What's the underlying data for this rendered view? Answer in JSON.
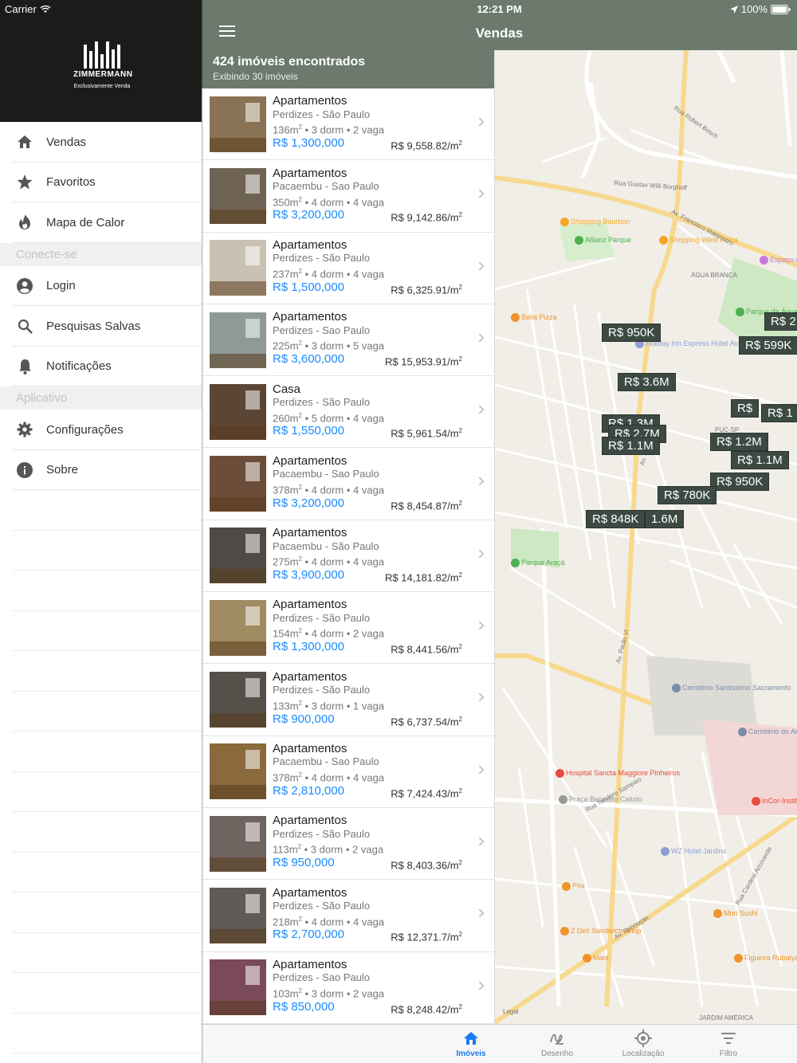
{
  "status": {
    "carrier": "Carrier",
    "time": "12:21 PM",
    "battery": "100%"
  },
  "sidebar": {
    "logo": {
      "brand": "ZIMMERMANN",
      "tagline": "Exclusivamente Venda"
    },
    "items": [
      {
        "label": "Vendas",
        "icon": "home-icon"
      },
      {
        "label": "Favoritos",
        "icon": "star-icon"
      },
      {
        "label": "Mapa de Calor",
        "icon": "flame-icon"
      }
    ],
    "section_connect": "Conecte-se",
    "connect_items": [
      {
        "label": "Login",
        "icon": "account-icon"
      },
      {
        "label": "Pesquisas Salvas",
        "icon": "search-icon"
      },
      {
        "label": "Notificações",
        "icon": "bell-icon"
      }
    ],
    "section_app": "Aplicativo",
    "app_items": [
      {
        "label": "Configurações",
        "icon": "gear-icon"
      },
      {
        "label": "Sobre",
        "icon": "info-icon"
      }
    ]
  },
  "header": {
    "title": "Vendas"
  },
  "list": {
    "count": "424 imóveis encontrados",
    "showing": "Exibindo 30 imóveis",
    "items": [
      {
        "type": "Apartamentos",
        "location": "Perdizes - São Paulo",
        "area": "136m",
        "dorm": "3 dorm",
        "vaga": "2 vaga",
        "price": "R$ 1,300,000",
        "ppm": "R$ 9,558.82/m",
        "color": "#8a7355"
      },
      {
        "type": "Apartamentos",
        "location": "Pacaembu - Sao Paulo",
        "area": "350m",
        "dorm": "4 dorm",
        "vaga": "4 vaga",
        "price": "R$ 3,200,000",
        "ppm": "R$ 9,142.86/m",
        "color": "#6e6252"
      },
      {
        "type": "Apartamentos",
        "location": "Perdizes - São Paulo",
        "area": "237m",
        "dorm": "4 dorm",
        "vaga": "4 vaga",
        "price": "R$ 1,500,000",
        "ppm": "R$ 6,325.91/m",
        "color": "#c9c2b4"
      },
      {
        "type": "Apartamentos",
        "location": "Perdizes - Sao Paulo",
        "area": "225m",
        "dorm": "3 dorm",
        "vaga": "5 vaga",
        "price": "R$ 3,600,000",
        "ppm": "R$ 15,953.91/m",
        "color": "#8d9a95"
      },
      {
        "type": "Casa",
        "location": "Perdizes - São Paulo",
        "area": "260m",
        "dorm": "5 dorm",
        "vaga": "4 vaga",
        "price": "R$ 1,550,000",
        "ppm": "R$ 5,961.54/m",
        "color": "#5b4636"
      },
      {
        "type": "Apartamentos",
        "location": "Pacaembu - Sao Paulo",
        "area": "378m",
        "dorm": "4 dorm",
        "vaga": "4 vaga",
        "price": "R$ 3,200,000",
        "ppm": "R$ 8,454.87/m",
        "color": "#6d4c3a"
      },
      {
        "type": "Apartamentos",
        "location": "Pacaembu - São Paulo",
        "area": "275m",
        "dorm": "4 dorm",
        "vaga": "4 vaga",
        "price": "R$ 3,900,000",
        "ppm": "R$ 14,181.82/m",
        "color": "#4f4a45"
      },
      {
        "type": "Apartamentos",
        "location": "Perdizes - São Paulo",
        "area": "154m",
        "dorm": "4 dorm",
        "vaga": "2 vaga",
        "price": "R$ 1,300,000",
        "ppm": "R$ 8,441.56/m",
        "color": "#a08b63"
      },
      {
        "type": "Apartamentos",
        "location": "Perdizes - São Paulo",
        "area": "133m",
        "dorm": "3 dorm",
        "vaga": "1 vaga",
        "price": "R$ 900,000",
        "ppm": "R$ 6,737.54/m",
        "color": "#55504a"
      },
      {
        "type": "Apartamentos",
        "location": "Pacaembu - Sao Paulo",
        "area": "378m",
        "dorm": "4 dorm",
        "vaga": "4 vaga",
        "price": "R$ 2,810,000",
        "ppm": "R$ 7,424.43/m",
        "color": "#8a6a3c"
      },
      {
        "type": "Apartamentos",
        "location": "Perdizes - São Paulo",
        "area": "113m",
        "dorm": "3 dorm",
        "vaga": "2 vaga",
        "price": "R$ 950,000",
        "ppm": "R$ 8,403.36/m",
        "color": "#6f6460"
      },
      {
        "type": "Apartamentos",
        "location": "Perdizes - São Paulo",
        "area": "218m",
        "dorm": "4 dorm",
        "vaga": "4 vaga",
        "price": "R$ 2,700,000",
        "ppm": "R$ 12,371.7/m",
        "color": "#5f5a55"
      },
      {
        "type": "Apartamentos",
        "location": "Perdizes - Sao Paulo",
        "area": "103m",
        "dorm": "3 dorm",
        "vaga": "2 vaga",
        "price": "R$ 850,000",
        "ppm": "R$ 8,248.42/m",
        "color": "#7a4a5a"
      }
    ]
  },
  "map": {
    "markers": [
      "R$ 950K",
      "R$ 3.6M",
      "R$ 1.3M",
      "R$ 2.7M",
      "R$ 1.1M",
      "R$ 1.2M",
      "R$ 1.1M",
      "R$ 950K",
      "R$ 780K",
      "R$ 848K",
      "1.6M",
      "R$ 599K",
      "R$ 2",
      "R$ 1",
      "R$"
    ],
    "pois": [
      {
        "label": "Shopping Bourbon",
        "color": "#f5a623"
      },
      {
        "label": "Allianz Parque",
        "color": "#4caf50"
      },
      {
        "label": "Shopping West Plaza",
        "color": "#f5a623"
      },
      {
        "label": "Bella Pizza",
        "color": "#f0932b"
      },
      {
        "label": "Holiday Inn Express Hotel Av. Sumaré",
        "color": "#8e9fd8"
      },
      {
        "label": "Parque da Água Br",
        "color": "#4caf50"
      },
      {
        "label": "Parque Araçá",
        "color": "#4caf50"
      },
      {
        "label": "Cemitério Santíssimo Sacramento",
        "color": "#7b8da6"
      },
      {
        "label": "Cemitério do Araçá",
        "color": "#7b8da6"
      },
      {
        "label": "Hospital Sancta Maggiore Pinheiros",
        "color": "#e74c3c"
      },
      {
        "label": "InCor-Instit do Coraçã",
        "color": "#e74c3c"
      },
      {
        "label": "Praça Benedito Calixto",
        "color": "#999999"
      },
      {
        "label": "WZ Hotel Jardins",
        "color": "#8e9fd8"
      },
      {
        "label": "Pita",
        "color": "#f0932b"
      },
      {
        "label": "Mori Sushi",
        "color": "#f0932b"
      },
      {
        "label": "Z Deli Sandwich Shop",
        "color": "#f0932b"
      },
      {
        "label": "Mani",
        "color": "#f0932b"
      },
      {
        "label": "Figueira Rubaiyat",
        "color": "#f0932b"
      },
      {
        "label": "Espaço das Américas",
        "color": "#c678dd"
      }
    ],
    "streets": [
      "Rua Robert Bosch",
      "Rua Gustav Willi Borghoff",
      "Av. Francisco Matarazzo",
      "Av. Sumaré",
      "Av. Paulo VI",
      "Rua Teodoro Sampaio",
      "Av. Rebouças",
      "Rua Cardeal Arcoverde",
      "ÁGUA BRANCA",
      "PUC-SP",
      "Legal",
      "JARDIM AMÉRICA"
    ]
  },
  "tabbar": {
    "tabs": [
      {
        "label": "Imóveis",
        "icon": "house-icon",
        "active": true
      },
      {
        "label": "Desenho",
        "icon": "draw-icon",
        "active": false
      },
      {
        "label": "Localização",
        "icon": "location-icon",
        "active": false
      },
      {
        "label": "Filtro",
        "icon": "filter-icon",
        "active": false
      }
    ]
  },
  "colors": {
    "nav": "#6b7a6c",
    "price": "#1a8cff",
    "marker": "#3c4a43",
    "active_tab": "#1a7cf0"
  }
}
